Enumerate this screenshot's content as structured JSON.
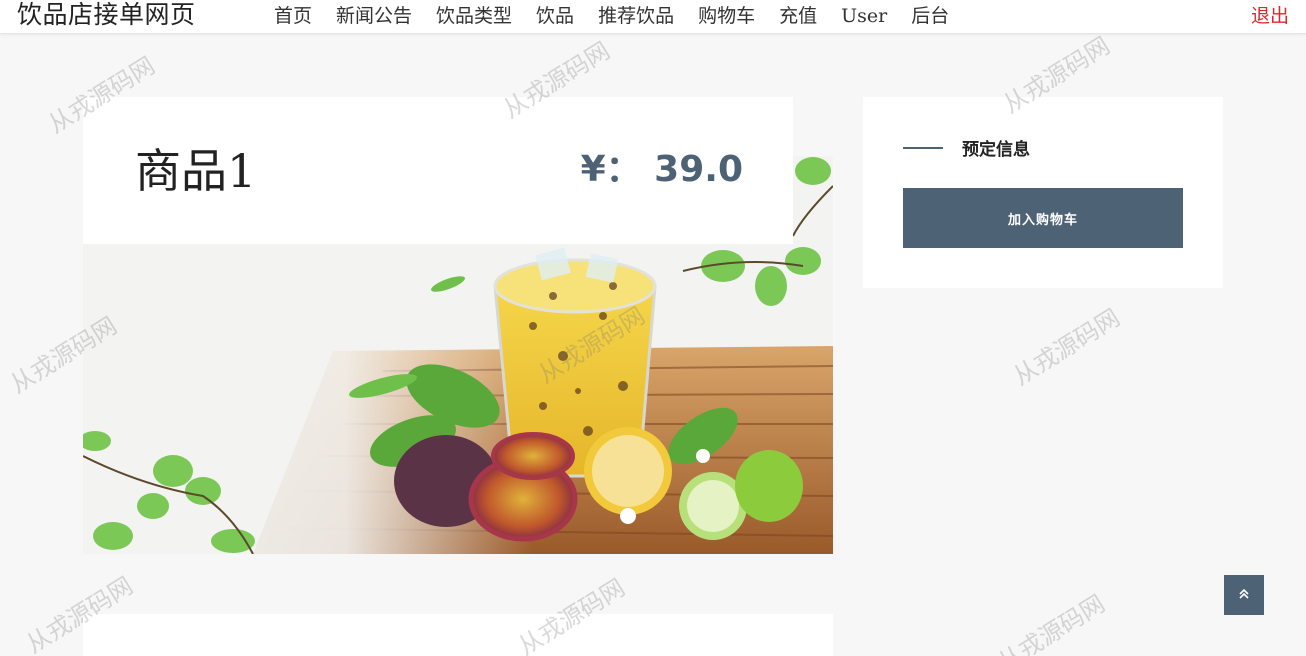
{
  "navbar": {
    "brand": "饮品店接单网页",
    "links": [
      "首页",
      "新闻公告",
      "饮品类型",
      "饮品",
      "推荐饮品",
      "购物车",
      "充值",
      "User",
      "后台"
    ],
    "logout": "退出"
  },
  "product": {
    "name": "商品1",
    "price": "¥： 39.0"
  },
  "sidebar": {
    "title": "预定信息",
    "add_to_cart": "加入购物车"
  },
  "watermark": "从戎源码网",
  "icons": {
    "back_to_top": "double-chevron-up-icon"
  },
  "colors": {
    "accent": "#4e6275",
    "logout": "#e0262c",
    "background": "#f7f7f7"
  }
}
